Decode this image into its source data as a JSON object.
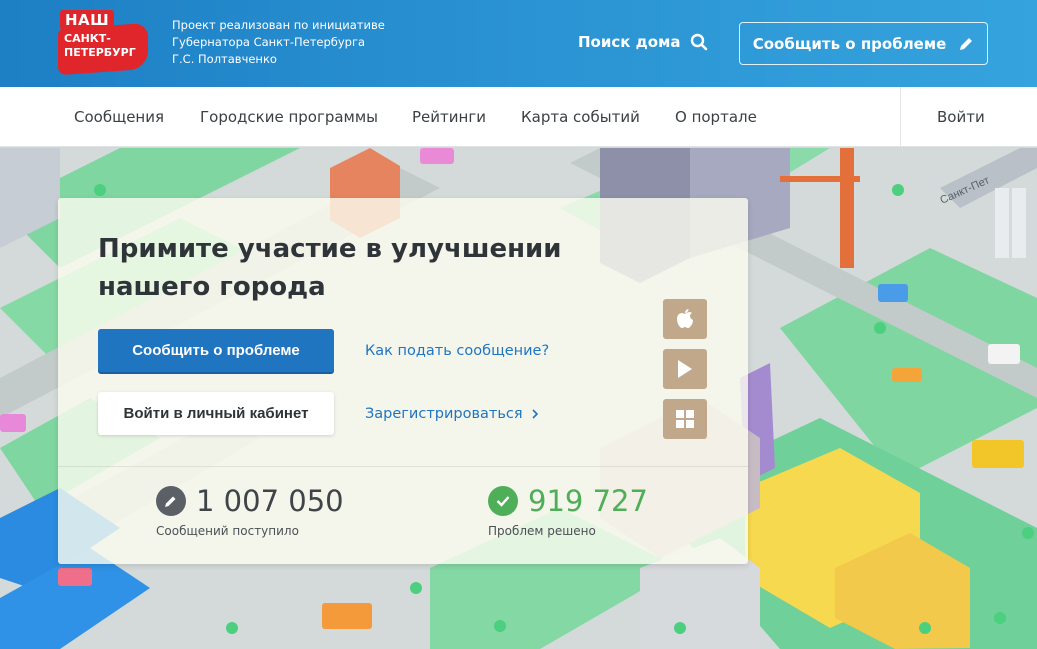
{
  "header": {
    "logo": {
      "line1": "НАШ",
      "line2": "САНКТ-",
      "line3": "ПЕТЕРБУРГ"
    },
    "initiative_text": [
      "Проект реализован по инициативе",
      "Губернатора Санкт-Петербурга",
      "Г.С. Полтавченко"
    ],
    "search_label": "Поиск дома",
    "report_label": "Сообщить о проблеме"
  },
  "nav": {
    "items": [
      {
        "label": "Сообщения"
      },
      {
        "label": "Городские программы"
      },
      {
        "label": "Рейтинги"
      },
      {
        "label": "Карта событий"
      },
      {
        "label": "О портале"
      }
    ],
    "login_label": "Войти"
  },
  "hero": {
    "title": "Примите участие в улучшении нашего города",
    "report_button": "Сообщить о проблеме",
    "cabinet_button": "Войти в личный кабинет",
    "how_to_link": "Как подать сообщение?",
    "register_link": "Зарегистрироваться",
    "apps": [
      {
        "icon": "apple-icon"
      },
      {
        "icon": "google-play-icon"
      },
      {
        "icon": "windows-icon"
      }
    ],
    "stats": {
      "received": {
        "value": "1 007 050",
        "label": "Сообщений поступило"
      },
      "solved": {
        "value": "919 727",
        "label": "Проблем решено"
      }
    }
  },
  "map": {
    "sign_text": "Санкт-Пет"
  },
  "colors": {
    "header_blue": "#2a93d3",
    "primary_button": "#1f75c0",
    "success_green": "#4fae58",
    "logo_red": "#e0252b"
  }
}
